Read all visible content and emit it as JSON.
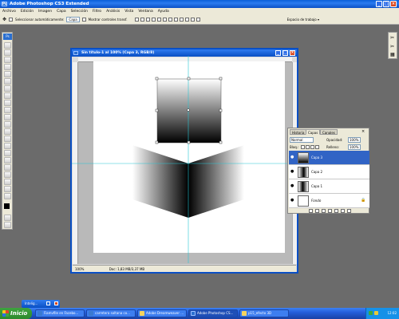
{
  "app": {
    "title": "Adobe Photoshop CS3 Extended"
  },
  "menubar": {
    "items": [
      "Archivo",
      "Edición",
      "Imagen",
      "Capa",
      "Selección",
      "Filtro",
      "Análisis",
      "Vista",
      "Ventana",
      "Ayuda"
    ]
  },
  "options": {
    "auto_select": "Seleccionar automáticamente:",
    "auto_select_value": "Capa",
    "show_controls": "Mostrar controles transf.",
    "workspace": "Espacio de trabajo"
  },
  "document": {
    "title": "Sin título-1 al 100% (Capa 3, RGB/8)",
    "zoom": "100%",
    "doc_info": "Doc: 1,83 MB/3,37 MB"
  },
  "layers_panel": {
    "tabs": [
      "Historia",
      "Capas",
      "Canales"
    ],
    "blend_mode": "Normal",
    "opacity_label": "Opacidad:",
    "opacity": "100%",
    "lock_label": "Bloq.:",
    "fill_label": "Relleno:",
    "fill": "100%",
    "layers": [
      {
        "name": "Capa 3",
        "selected": true
      },
      {
        "name": "Capa 2",
        "selected": false
      },
      {
        "name": "Capa 1",
        "selected": false
      },
      {
        "name": "Fondo",
        "selected": false
      }
    ]
  },
  "minimized": {
    "label": "Intelig..."
  },
  "taskbar": {
    "start": "Inicio",
    "tasks": [
      "Fiamvfile en Facebo...",
      "carretera soltana co...",
      "Adobe Dreamweaver ...",
      "Adobe Photoshop CS...",
      "p15_efecto 3D"
    ],
    "active_task": 3,
    "clock": "12:02"
  },
  "colors": {
    "accent": "#0a4fc4",
    "selected_layer": "#3164c5",
    "workspace_bg": "#6b6b6b"
  }
}
